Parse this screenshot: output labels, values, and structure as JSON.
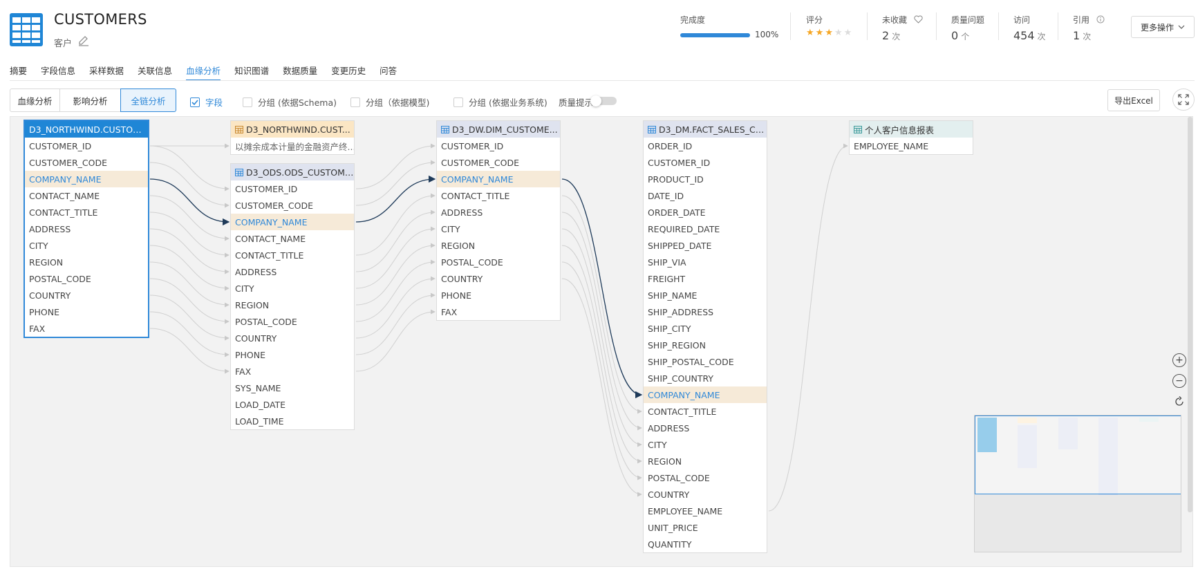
{
  "header": {
    "title": "CUSTOMERS",
    "subtitle": "客户",
    "stats": {
      "completeness": {
        "label": "完成度",
        "value": "100%",
        "fraction": 1.0
      },
      "rating": {
        "label": "评分",
        "stars": 3,
        "max": 5
      },
      "favorite": {
        "label": "未收藏",
        "value": "2",
        "unit": "次"
      },
      "quality": {
        "label": "质量问题",
        "value": "0",
        "unit": "个"
      },
      "visits": {
        "label": "访问",
        "value": "454",
        "unit": "次"
      },
      "refs": {
        "label": "引用",
        "value": "1",
        "unit": "次"
      }
    },
    "more_label": "更多操作"
  },
  "tabs": [
    "摘要",
    "字段信息",
    "采样数据",
    "关联信息",
    "血缘分析",
    "知识图谱",
    "数据质量",
    "变更历史",
    "问答"
  ],
  "active_tab": "血缘分析",
  "toolbar": {
    "segments": [
      "血缘分析",
      "影响分析",
      "全链分析"
    ],
    "active_segment": "全链分析",
    "checkboxes": [
      {
        "label": "字段",
        "checked": true
      },
      {
        "label": "分组 (依据Schema)",
        "checked": false
      },
      {
        "label": "分组（依据模型)",
        "checked": false
      },
      {
        "label": "分组 (依据业务系统)",
        "checked": false
      }
    ],
    "quality_hint_label": "质量提示",
    "quality_hint_on": false,
    "export_label": "导出Excel"
  },
  "lineage": {
    "nodes": [
      {
        "id": "src",
        "title": "D3_NORTHWIND.CUSTOM...",
        "kind": "table-focus",
        "fields": [
          "CUSTOMER_ID",
          "CUSTOMER_CODE",
          "COMPANY_NAME",
          "CONTACT_NAME",
          "CONTACT_TITLE",
          "ADDRESS",
          "CITY",
          "REGION",
          "POSTAL_CODE",
          "COUNTRY",
          "PHONE",
          "FAX"
        ],
        "highlight": "COMPANY_NAME"
      },
      {
        "id": "proc",
        "title": "D3_NORTHWIND.CUST...",
        "kind": "process",
        "fields": [
          "以摊余成本计量的金融资产终..."
        ],
        "highlight": null
      },
      {
        "id": "ods",
        "title": "D3_ODS.ODS_CUSTOME...",
        "kind": "table",
        "fields": [
          "CUSTOMER_ID",
          "CUSTOMER_CODE",
          "COMPANY_NAME",
          "CONTACT_NAME",
          "CONTACT_TITLE",
          "ADDRESS",
          "CITY",
          "REGION",
          "POSTAL_CODE",
          "COUNTRY",
          "PHONE",
          "FAX",
          "SYS_NAME",
          "LOAD_DATE",
          "LOAD_TIME"
        ],
        "highlight": "COMPANY_NAME"
      },
      {
        "id": "dim",
        "title": "D3_DW.DIM_CUSTOME...",
        "kind": "table",
        "fields": [
          "CUSTOMER_ID",
          "CUSTOMER_CODE",
          "COMPANY_NAME",
          "CONTACT_TITLE",
          "ADDRESS",
          "CITY",
          "REGION",
          "POSTAL_CODE",
          "COUNTRY",
          "PHONE",
          "FAX"
        ],
        "highlight": "COMPANY_NAME"
      },
      {
        "id": "fact",
        "title": "D3_DM.FACT_SALES_CU...",
        "kind": "table",
        "fields": [
          "ORDER_ID",
          "CUSTOMER_ID",
          "PRODUCT_ID",
          "DATE_ID",
          "ORDER_DATE",
          "REQUIRED_DATE",
          "SHIPPED_DATE",
          "SHIP_VIA",
          "FREIGHT",
          "SHIP_NAME",
          "SHIP_ADDRESS",
          "SHIP_CITY",
          "SHIP_REGION",
          "SHIP_POSTAL_CODE",
          "SHIP_COUNTRY",
          "COMPANY_NAME",
          "CONTACT_TITLE",
          "ADDRESS",
          "CITY",
          "REGION",
          "POSTAL_CODE",
          "COUNTRY",
          "EMPLOYEE_NAME",
          "UNIT_PRICE",
          "QUANTITY"
        ],
        "highlight": "COMPANY_NAME"
      },
      {
        "id": "report",
        "title": "个人客户信息报表",
        "kind": "report",
        "fields": [
          "EMPLOYEE_NAME"
        ],
        "highlight": null
      }
    ],
    "edges": [
      {
        "from": "src",
        "from_field": "CUSTOMER_ID",
        "to": "proc",
        "to_field": "以摊余成本计量的金融资产终...",
        "active": false
      },
      {
        "from": "src",
        "from_field": "CUSTOMER_ID",
        "to": "ods",
        "to_field": "CUSTOMER_ID",
        "active": false
      },
      {
        "from": "src",
        "from_field": "CUSTOMER_CODE",
        "to": "ods",
        "to_field": "CUSTOMER_CODE",
        "active": false
      },
      {
        "from": "src",
        "from_field": "COMPANY_NAME",
        "to": "ods",
        "to_field": "COMPANY_NAME",
        "active": true
      },
      {
        "from": "src",
        "from_field": "CONTACT_NAME",
        "to": "ods",
        "to_field": "CONTACT_NAME",
        "active": false
      },
      {
        "from": "src",
        "from_field": "CONTACT_TITLE",
        "to": "ods",
        "to_field": "CONTACT_TITLE",
        "active": false
      },
      {
        "from": "src",
        "from_field": "ADDRESS",
        "to": "ods",
        "to_field": "ADDRESS",
        "active": false
      },
      {
        "from": "src",
        "from_field": "CITY",
        "to": "ods",
        "to_field": "CITY",
        "active": false
      },
      {
        "from": "src",
        "from_field": "REGION",
        "to": "ods",
        "to_field": "REGION",
        "active": false
      },
      {
        "from": "src",
        "from_field": "POSTAL_CODE",
        "to": "ods",
        "to_field": "POSTAL_CODE",
        "active": false
      },
      {
        "from": "src",
        "from_field": "COUNTRY",
        "to": "ods",
        "to_field": "COUNTRY",
        "active": false
      },
      {
        "from": "src",
        "from_field": "PHONE",
        "to": "ods",
        "to_field": "PHONE",
        "active": false
      },
      {
        "from": "src",
        "from_field": "FAX",
        "to": "ods",
        "to_field": "FAX",
        "active": false
      },
      {
        "from": "ods",
        "from_field": "CUSTOMER_ID",
        "to": "dim",
        "to_field": "CUSTOMER_ID",
        "active": false
      },
      {
        "from": "ods",
        "from_field": "CUSTOMER_CODE",
        "to": "dim",
        "to_field": "CUSTOMER_CODE",
        "active": false
      },
      {
        "from": "ods",
        "from_field": "COMPANY_NAME",
        "to": "dim",
        "to_field": "COMPANY_NAME",
        "active": true
      },
      {
        "from": "ods",
        "from_field": "CONTACT_TITLE",
        "to": "dim",
        "to_field": "CONTACT_TITLE",
        "active": false
      },
      {
        "from": "ods",
        "from_field": "ADDRESS",
        "to": "dim",
        "to_field": "ADDRESS",
        "active": false
      },
      {
        "from": "ods",
        "from_field": "CITY",
        "to": "dim",
        "to_field": "CITY",
        "active": false
      },
      {
        "from": "ods",
        "from_field": "REGION",
        "to": "dim",
        "to_field": "REGION",
        "active": false
      },
      {
        "from": "ods",
        "from_field": "POSTAL_CODE",
        "to": "dim",
        "to_field": "POSTAL_CODE",
        "active": false
      },
      {
        "from": "ods",
        "from_field": "COUNTRY",
        "to": "dim",
        "to_field": "COUNTRY",
        "active": false
      },
      {
        "from": "ods",
        "from_field": "PHONE",
        "to": "dim",
        "to_field": "PHONE",
        "active": false
      },
      {
        "from": "ods",
        "from_field": "FAX",
        "to": "dim",
        "to_field": "FAX",
        "active": false
      },
      {
        "from": "dim",
        "from_field": "COMPANY_NAME",
        "to": "fact",
        "to_field": "COMPANY_NAME",
        "active": true
      },
      {
        "from": "dim",
        "from_field": "CONTACT_TITLE",
        "to": "fact",
        "to_field": "CONTACT_TITLE",
        "active": false
      },
      {
        "from": "dim",
        "from_field": "ADDRESS",
        "to": "fact",
        "to_field": "ADDRESS",
        "active": false
      },
      {
        "from": "dim",
        "from_field": "CITY",
        "to": "fact",
        "to_field": "CITY",
        "active": false
      },
      {
        "from": "dim",
        "from_field": "REGION",
        "to": "fact",
        "to_field": "REGION",
        "active": false
      },
      {
        "from": "dim",
        "from_field": "POSTAL_CODE",
        "to": "fact",
        "to_field": "POSTAL_CODE",
        "active": false
      },
      {
        "from": "dim",
        "from_field": "COUNTRY",
        "to": "fact",
        "to_field": "COUNTRY",
        "active": false
      },
      {
        "from": "fact",
        "from_field": "EMPLOYEE_NAME",
        "to": "report",
        "to_field": "EMPLOYEE_NAME",
        "active": false
      }
    ]
  },
  "colors": {
    "accent": "#2f88d8",
    "focus_header": "#1f86d6",
    "highlight_row": "#f6ead8",
    "active_edge": "#1f3b5a",
    "inactive_edge": "#d0d0d0",
    "view_header": "#dfe3ef",
    "process_header": "#fbe6c4",
    "report_header": "#e3efef"
  },
  "icons": {
    "table": "grid-table-icon",
    "edit": "pencil-icon",
    "heart": "heart-icon",
    "info": "info-icon",
    "chevron": "chevron-down-icon",
    "fullscreen": "expand-icon",
    "zoom_in": "plus-circle-icon",
    "zoom_out": "minus-circle-icon",
    "reset": "refresh-icon"
  }
}
